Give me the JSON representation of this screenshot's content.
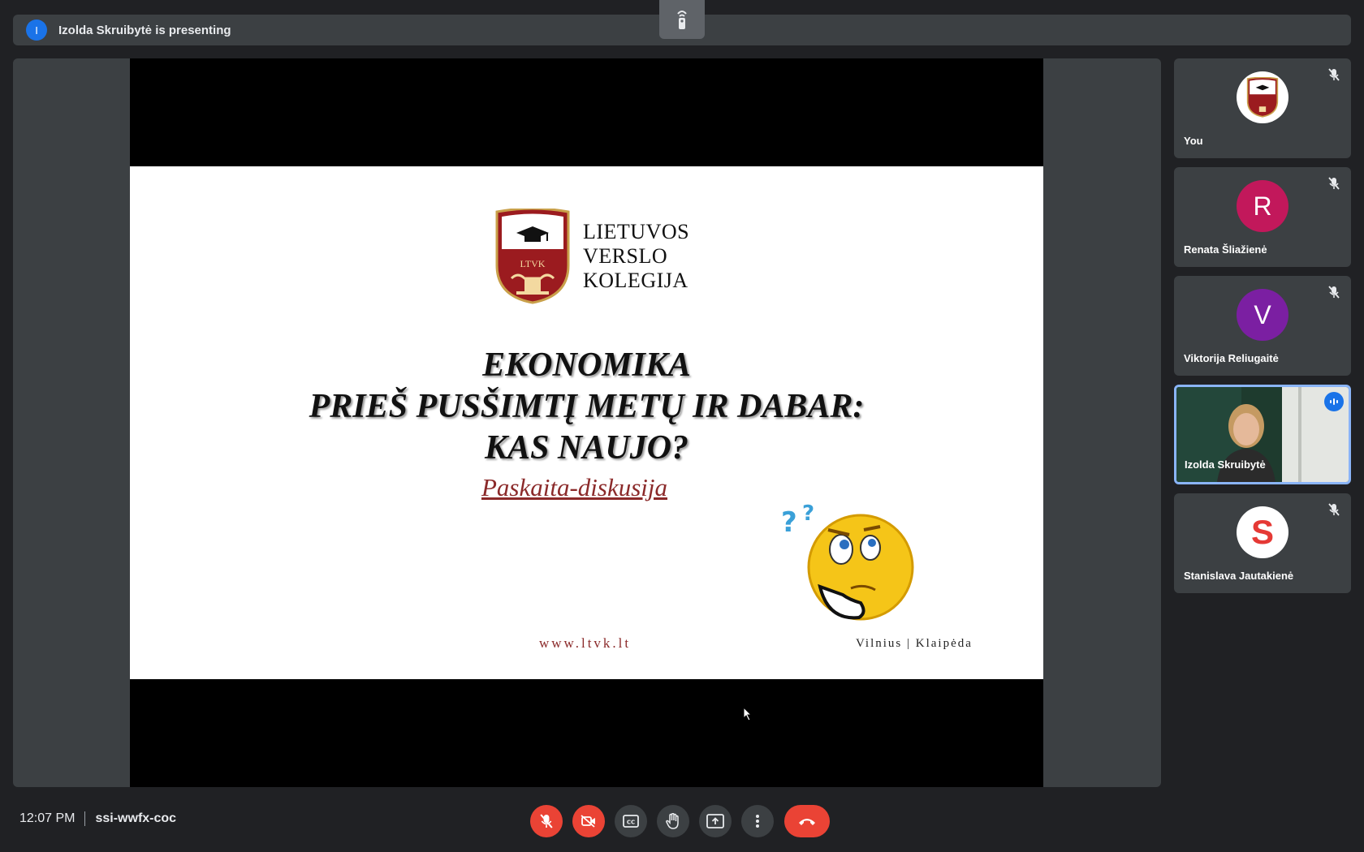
{
  "banner": {
    "avatar_initial": "I",
    "text": "Izolda Skruibytė is presenting"
  },
  "slide": {
    "logo_badge": "LTVK",
    "logo_lines": [
      "LIETUVOS",
      "VERSLO",
      "KOLEGIJA"
    ],
    "title_lines": [
      "EKONOMIKA",
      "PRIEŠ PUSŠIMTĮ METŲ IR DABAR:",
      "KAS NAUJO?"
    ],
    "subtitle": "Paskaita-diskusija",
    "website": "www.ltvk.lt",
    "cities": "Vilnius | Klaipėda"
  },
  "participants": [
    {
      "name": "You",
      "avatar": "logo",
      "muted": true
    },
    {
      "name": "Renata Šliažienė",
      "initial": "R",
      "color": "#c2185b",
      "muted": true
    },
    {
      "name": "Viktorija Reliugaitė",
      "initial": "V",
      "color": "#7b1fa2",
      "muted": true
    },
    {
      "name": "Izolda Skruibytė",
      "avatar": "video",
      "speaking": true
    },
    {
      "name": "Stanislava Jautakienė",
      "initial": "S",
      "color": "#ffffff",
      "muted": true
    }
  ],
  "meeting": {
    "time": "12:07 PM",
    "code": "ssi-wwfx-coc"
  },
  "controls": [
    "mic-off",
    "camera-off",
    "captions",
    "raise-hand",
    "present",
    "more-options",
    "leave-call"
  ],
  "colors": {
    "background": "#202124",
    "surface": "#3c4043",
    "danger": "#ea4335",
    "accent": "#1a73e8",
    "brand_red": "#8b2a2a"
  }
}
